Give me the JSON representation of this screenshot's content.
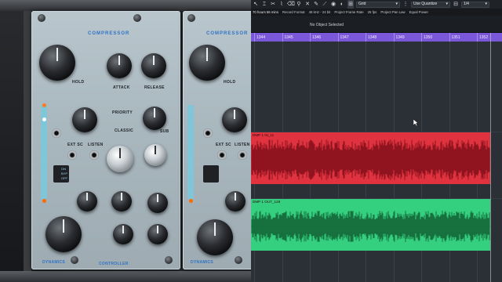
{
  "hardware": {
    "module1": {
      "title": "COMPRESSOR",
      "labels": [
        "HOLD",
        "ATTACK",
        "RELEASE",
        "PRIORITY",
        "CLASSIC",
        "SUB",
        "EXT SC",
        "LISTEN",
        "ON",
        "BYP",
        "OFF",
        "DYNAMICS"
      ],
      "footer": "CONTROLLER"
    },
    "module2": {
      "title": "COMPRESSOR",
      "labels": [
        "HOLD",
        "EXT SC",
        "LISTEN",
        "DYNAMICS"
      ]
    }
  },
  "daw": {
    "toolbar": {
      "grid_mode": "Grid",
      "quantize": "Use Quantize",
      "quantize_value": "1/4"
    },
    "status": [
      {
        "label": "",
        "value": "70 hours 56 mins"
      },
      {
        "label": "Record Format",
        "value": ""
      },
      {
        "label": "48 kHz - 24 bit",
        "value": ""
      },
      {
        "label": "Project Frame Rate",
        "value": ""
      },
      {
        "label": "25 fps",
        "value": ""
      },
      {
        "label": "Project Pan Law",
        "value": ""
      },
      {
        "label": "Equal Power",
        "value": ""
      }
    ],
    "info_line": "No Object Selected",
    "ruler_bars": [
      "1344",
      "1345",
      "1346",
      "1347",
      "1348",
      "1349",
      "1350",
      "1351",
      "1352"
    ],
    "events": [
      {
        "name": "DMP 1 IN_11",
        "color": "#e0323f",
        "wave_color": "#8f1420"
      },
      {
        "name": "DMP 1 OUT_128",
        "color": "#35d07f",
        "wave_color": "#16713f"
      }
    ]
  }
}
